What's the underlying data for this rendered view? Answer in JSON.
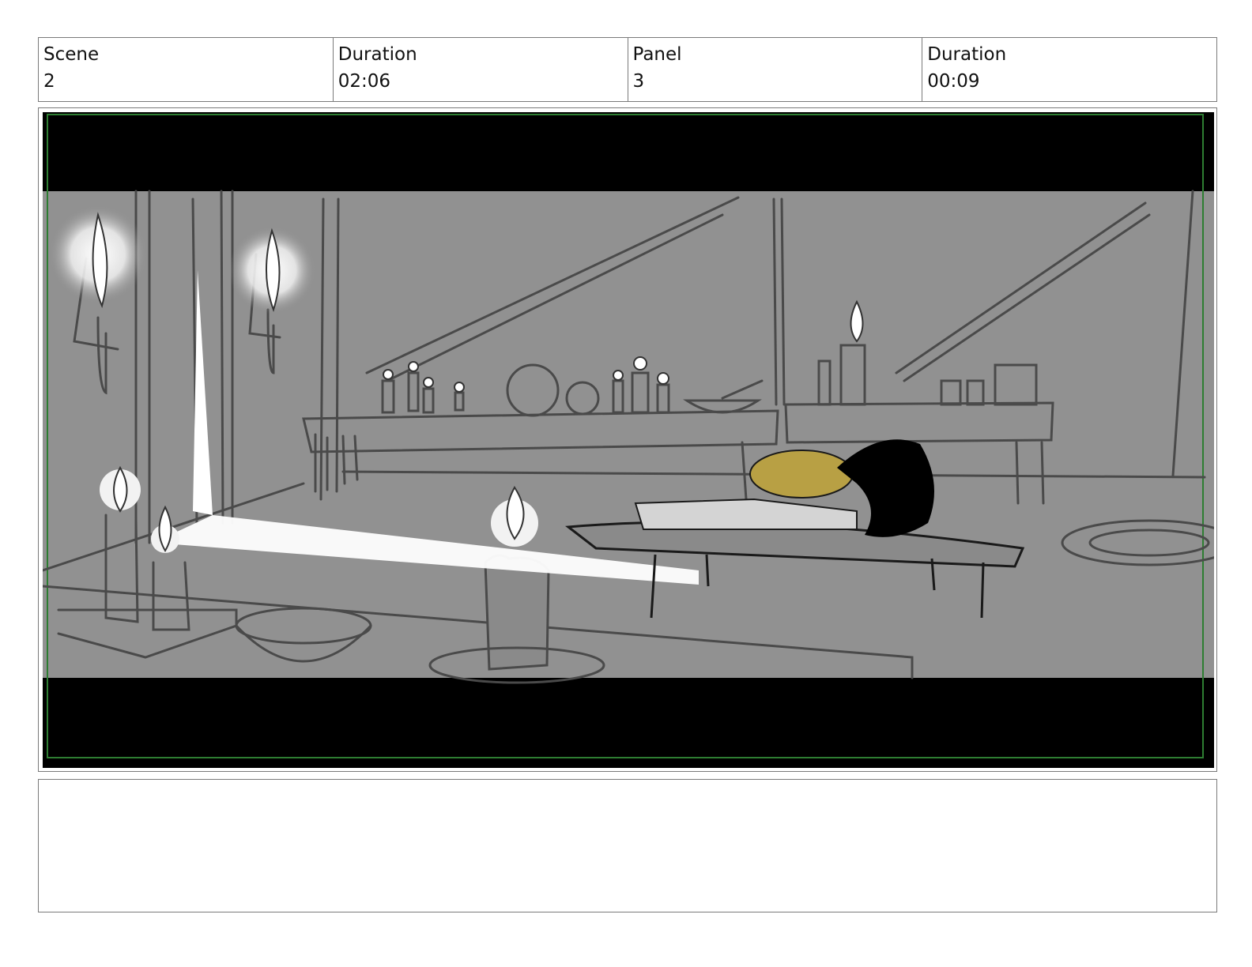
{
  "header": {
    "scene_label": "Scene",
    "scene_value": "2",
    "scene_duration_label": "Duration",
    "scene_duration_value": "02:06",
    "panel_label": "Panel",
    "panel_value": "3",
    "panel_duration_label": "Duration",
    "panel_duration_value": "00:09"
  },
  "notes": {
    "text": ""
  },
  "colors": {
    "letterbox": "#000000",
    "background": "#919191",
    "safe_frame": "#2e7d32",
    "accent_hair": "#b8a044"
  }
}
